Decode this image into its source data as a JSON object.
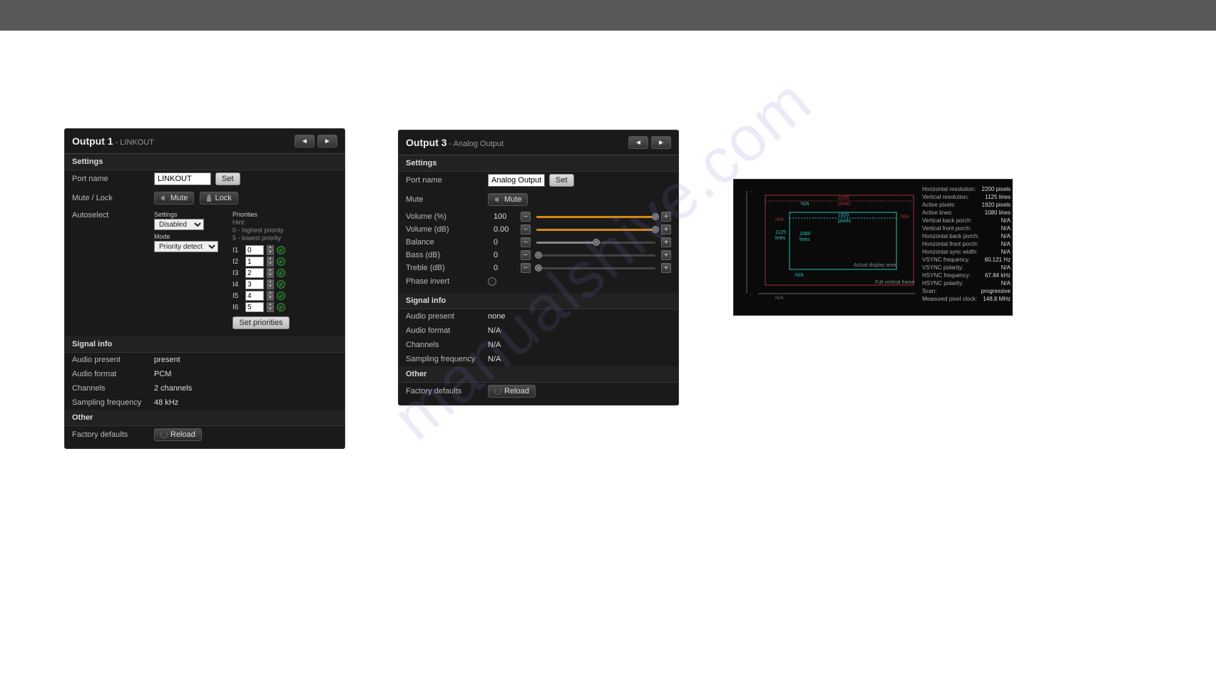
{
  "output1": {
    "title": "Output 1",
    "subtitle": "LINKOUT",
    "settings_h": "Settings",
    "port_label": "Port name",
    "port_value": "LINKOUT",
    "set_btn": "Set",
    "mute_lock_label": "Mute / Lock",
    "mute_btn": "Mute",
    "lock_btn": "Lock",
    "autoselect_label": "Autoselect",
    "autoselect_settings": "Settings",
    "autoselect_value": "Disabled",
    "mode_label": "Mode",
    "mode_value": "Priority detect",
    "priorities_label": "Priorities",
    "hint1": "Hint:",
    "hint2": "0 - highest priority",
    "hint3": "5 - lowest priority",
    "prio_rows": [
      {
        "label": "I1",
        "val": "0"
      },
      {
        "label": "I2",
        "val": "1"
      },
      {
        "label": "I3",
        "val": "2"
      },
      {
        "label": "I4",
        "val": "3"
      },
      {
        "label": "I5",
        "val": "4"
      },
      {
        "label": "I6",
        "val": "5"
      }
    ],
    "set_priorities_btn": "Set priorities",
    "signal_h": "Signal info",
    "signal_rows": [
      {
        "k": "Audio present",
        "v": "present"
      },
      {
        "k": "Audio format",
        "v": "PCM"
      },
      {
        "k": "Channels",
        "v": "2 channels"
      },
      {
        "k": "Sampling frequency",
        "v": "48 kHz"
      }
    ],
    "other_h": "Other",
    "factory_label": "Factory defaults",
    "reload_btn": "Reload"
  },
  "output3": {
    "title": "Output 3",
    "subtitle": "Analog Output",
    "settings_h": "Settings",
    "port_label": "Port name",
    "port_value": "Analog Output",
    "set_btn": "Set",
    "mute_label": "Mute",
    "mute_btn": "Mute",
    "sliders": [
      {
        "label": "Volume (%)",
        "val": "100",
        "fill": 100,
        "color": "#d18a1a"
      },
      {
        "label": "Volume (dB)",
        "val": "0.00",
        "fill": 100,
        "color": "#d18a1a"
      },
      {
        "label": "Balance",
        "val": "0",
        "fill": 50,
        "color": "#888"
      },
      {
        "label": "Bass (dB)",
        "val": "0",
        "fill": 2,
        "color": "#888"
      },
      {
        "label": "Treble (dB)",
        "val": "0",
        "fill": 2,
        "color": "#888"
      }
    ],
    "phase_label": "Phase invert",
    "signal_h": "Signal info",
    "signal_rows": [
      {
        "k": "Audio present",
        "v": "none"
      },
      {
        "k": "Audio format",
        "v": "N/A"
      },
      {
        "k": "Channels",
        "v": "N/A"
      },
      {
        "k": "Sampling frequency",
        "v": "N/A"
      }
    ],
    "other_h": "Other",
    "factory_label": "Factory defaults",
    "reload_btn": "Reload"
  },
  "sigpanel": {
    "actual_area": "Actual display area",
    "full_frame": "Full vertical frame",
    "rows": [
      {
        "k": "Horizontal resolution:",
        "v": "2200 pixels"
      },
      {
        "k": "Vertical resolution:",
        "v": "1125 lines"
      },
      {
        "k": "Active pixels:",
        "v": "1920 pixels"
      },
      {
        "k": "Active lines:",
        "v": "1080 lines"
      },
      {
        "k": "Vertical back porch:",
        "v": "N/A"
      },
      {
        "k": "Vertical front porch:",
        "v": "N/A"
      },
      {
        "k": "Horizontal back porch:",
        "v": "N/A"
      },
      {
        "k": "Horizontal front porch:",
        "v": "N/A"
      },
      {
        "k": "Horizontal sync width:",
        "v": "N/A"
      },
      {
        "k": "VSYNC frequency:",
        "v": "60.121 Hz"
      },
      {
        "k": "VSYNC polarity:",
        "v": "N/A"
      },
      {
        "k": "HSYNC frequency:",
        "v": "67.84 kHz"
      },
      {
        "k": "HSYNC polarity:",
        "v": "N/A"
      },
      {
        "k": "Scan:",
        "v": "progressive"
      },
      {
        "k": "Measured pixel clock:",
        "v": "148.8 MHz"
      }
    ],
    "diag": {
      "na": "N/A",
      "lines1125": "1125\nlines",
      "lines1080": "1080\nlines",
      "pixels2200": "2200\npixels",
      "pixels1920": "1920\npixels"
    }
  },
  "watermark": "manualshive.com"
}
